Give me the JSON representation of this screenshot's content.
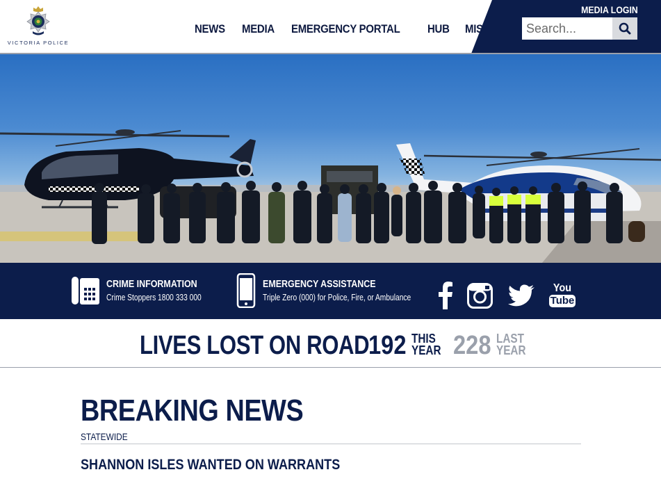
{
  "brand": {
    "logo_text": "VICTORIA POLICE"
  },
  "nav": {
    "items": [
      {
        "label": "NEWS"
      },
      {
        "label": "MEDIA"
      },
      {
        "label": "EMERGENCY PORTAL"
      },
      {
        "label": "HUB"
      },
      {
        "label": "MISSING"
      }
    ]
  },
  "header": {
    "media_login": "MEDIA LOGIN",
    "search_placeholder": "Search..."
  },
  "hero": {
    "alt": "Police helicopters and officers on tarmac"
  },
  "info": {
    "crime": {
      "title": "CRIME INFORMATION",
      "subtitle": "Crime Stoppers 1800 333 000"
    },
    "emergency": {
      "title": "EMERGENCY ASSISTANCE",
      "subtitle": "Triple Zero (000) for Police, Fire, or Ambulance"
    },
    "social": [
      "facebook-icon",
      "instagram-icon",
      "twitter-icon",
      "youtube-icon"
    ],
    "youtube_top": "You",
    "youtube_bottom": "Tube"
  },
  "road_toll": {
    "title": "LIVES LOST ON ROAD",
    "this_year_value": "192",
    "this_year_label_1": "THIS",
    "this_year_label_2": "YEAR",
    "last_year_value": "228",
    "last_year_label_1": "LAST",
    "last_year_label_2": "YEAR"
  },
  "breaking_news": {
    "heading": "BREAKING NEWS",
    "category": "STATEWIDE",
    "headline": "SHANNON ISLES WANTED ON WARRANTS"
  },
  "colors": {
    "navy": "#0c1d4b",
    "grey_text": "#9aa0ab"
  }
}
